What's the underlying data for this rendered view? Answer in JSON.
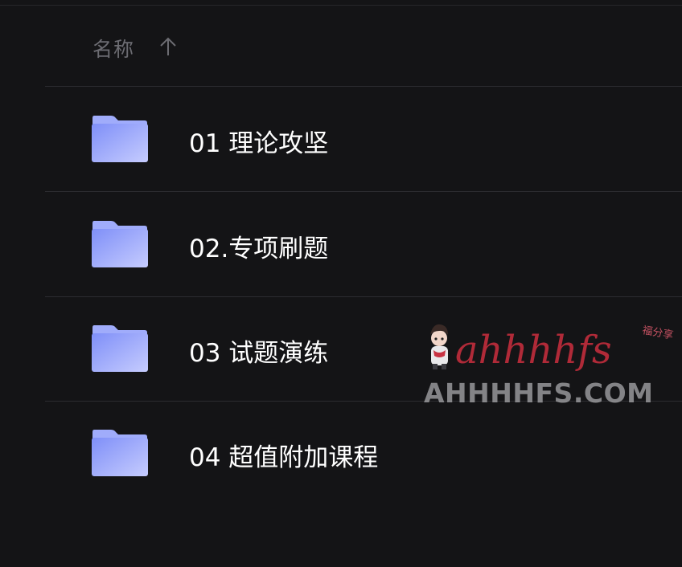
{
  "header": {
    "column_label": "名称",
    "sort_icon": "arrow-up-icon"
  },
  "files": [
    {
      "name": "01 理论攻坚",
      "icon": "folder-icon"
    },
    {
      "name": "02.专项刷题",
      "icon": "folder-icon"
    },
    {
      "name": "03 试题演练",
      "icon": "folder-icon"
    },
    {
      "name": "04 超值附加课程",
      "icon": "folder-icon"
    }
  ],
  "watermark": {
    "logo_text": "ahhhhfs",
    "badge_text": "福分享",
    "site_text": "AHHHHFS.COM"
  },
  "colors": {
    "background": "#141416",
    "divider": "#2c2c30",
    "header_text": "#6c6c72",
    "row_text": "#ffffff",
    "folder_front": "#8f9dfb",
    "folder_back": "#a4b0fc"
  }
}
